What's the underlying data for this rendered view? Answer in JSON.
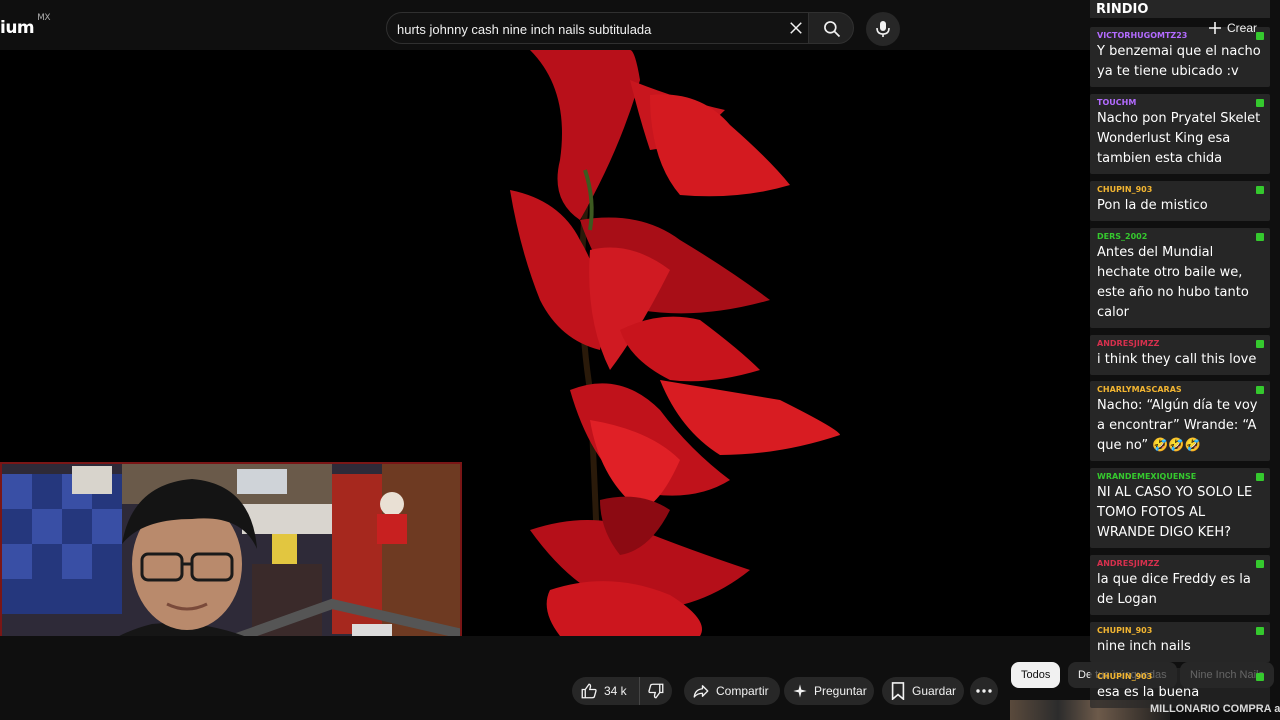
{
  "header": {
    "logo_text": "ium",
    "logo_region": "MX",
    "search_value": "hurts johnny cash nine inch nails subtitulada",
    "create_label": "Crear"
  },
  "actions": {
    "like_count": "34 k",
    "share_label": "Compartir",
    "ask_label": "Preguntar",
    "save_label": "Guardar"
  },
  "filters": {
    "chips": [
      "Todos",
      "De tus búsquedas",
      "Nine Inch Nails"
    ]
  },
  "recommendation": {
    "title": "MILLONARIO COMPRA a la"
  },
  "chat": {
    "top_text": "RINDIO",
    "messages": [
      {
        "user": "VICTORHUGOMTZ23",
        "color": "#b36bff",
        "text": "Y benzemai que el nacho ya te tiene ubicado :v"
      },
      {
        "user": "TOUCHM",
        "color": "#b36bff",
        "text": "Nacho pon Pryatel Skelet Wonderlust King esa tambien esta chida"
      },
      {
        "user": "CHUPIN_903",
        "color": "#f2b531",
        "text": "Pon la de mistico"
      },
      {
        "user": "DERS_2002",
        "color": "#35c92e",
        "text": "Antes del Mundial hechate otro baile we, este año no hubo tanto calor"
      },
      {
        "user": "ANDRESJIMZZ",
        "color": "#d6304d",
        "text": "i think they call this love"
      },
      {
        "user": "CHARLYMASCARAS",
        "color": "#f2b531",
        "text": "Nacho: “Algún día te voy a encontrar” Wrande: “A que no” 🤣🤣🤣"
      },
      {
        "user": "WRANDEMEXIQUENSE",
        "color": "#35c92e",
        "text": "NI AL CASO YO SOLO LE TOMO FOTOS AL WRANDE DIGO KEH?"
      },
      {
        "user": "ANDRESJIMZZ",
        "color": "#d6304d",
        "text": "la que dice Freddy es la de Logan"
      },
      {
        "user": "CHUPIN_903",
        "color": "#f2b531",
        "text": "nine inch nails"
      },
      {
        "user": "CHUPIN_903",
        "color": "#f2b531",
        "text": "esa es la buena"
      }
    ]
  }
}
